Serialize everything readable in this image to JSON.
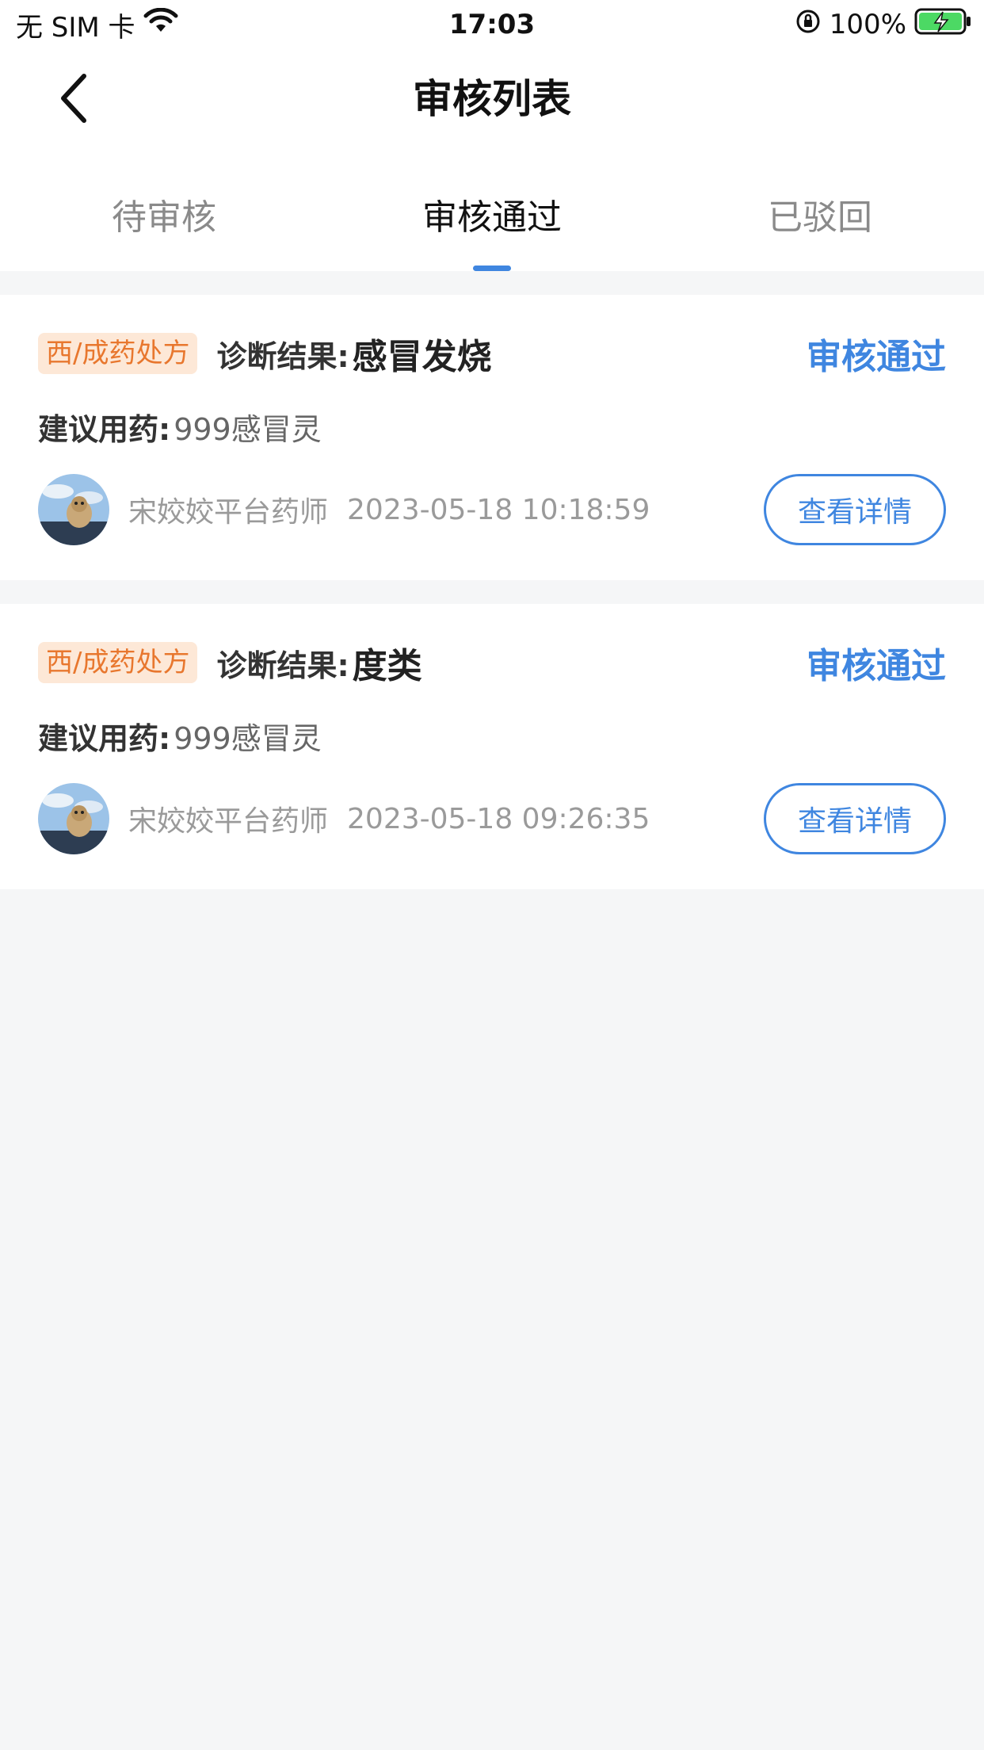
{
  "status_bar": {
    "carrier": "无 SIM 卡",
    "time": "17:03",
    "battery": "100%"
  },
  "nav": {
    "title": "审核列表"
  },
  "tabs": [
    {
      "label": "待审核",
      "active": false
    },
    {
      "label": "审核通过",
      "active": true
    },
    {
      "label": "已驳回",
      "active": false
    }
  ],
  "items": [
    {
      "tag": "西/成药处方",
      "diagnosis_label": "诊断结果:",
      "diagnosis": "感冒发烧",
      "status": "审核通过",
      "medication_label": "建议用药:",
      "medication": "999感冒灵",
      "pharmacist": "宋姣姣平台药师",
      "time": "2023-05-18 10:18:59",
      "detail_label": "查看详情"
    },
    {
      "tag": "西/成药处方",
      "diagnosis_label": "诊断结果:",
      "diagnosis": "度类",
      "status": "审核通过",
      "medication_label": "建议用药:",
      "medication": "999感冒灵",
      "pharmacist": "宋姣姣平台药师",
      "time": "2023-05-18 09:26:35",
      "detail_label": "查看详情"
    }
  ],
  "colors": {
    "accent": "#3f86e0",
    "tag_bg": "#fde8d7",
    "tag_text": "#e8772e",
    "page_bg": "#f5f6f7",
    "battery_green": "#4cd964"
  },
  "icons": [
    "wifi-icon",
    "orientation-lock-icon",
    "battery-charging-icon",
    "back-chevron-icon"
  ]
}
